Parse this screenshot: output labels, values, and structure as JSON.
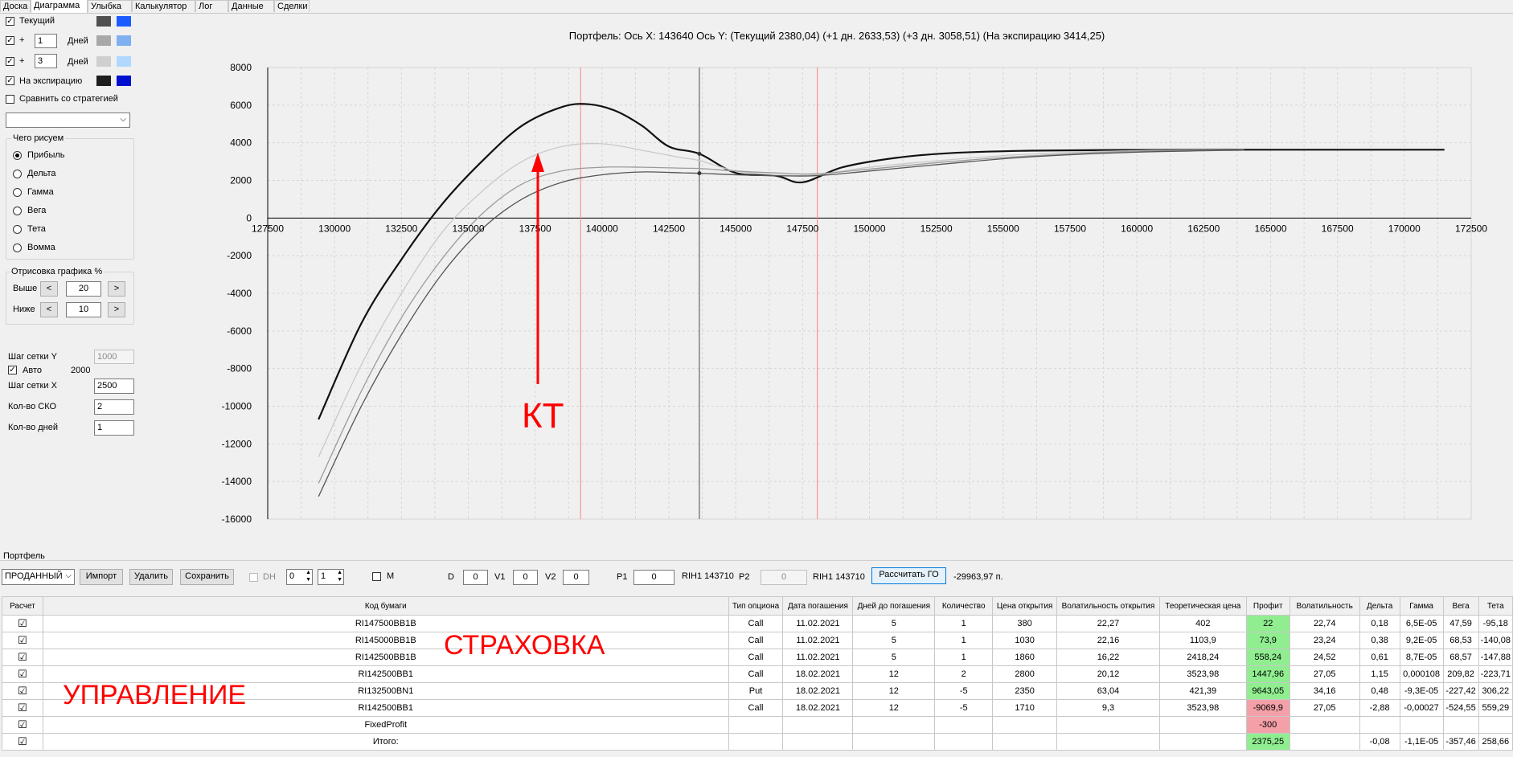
{
  "tabs": [
    "Доска",
    "Диаграмма",
    "Улыбка",
    "Калькулятор",
    "Лог",
    "Данные",
    "Сделки"
  ],
  "active_tab": "Диаграмма",
  "left": {
    "current_label": "Текущий",
    "plus": "+",
    "days_1": "1",
    "days_3": "3",
    "days_label": "Дней",
    "expiry_label": "На экспирацию",
    "compare_label": "Сравнить со стратегией",
    "what_title": "Чего рисуем",
    "radios": [
      "Прибыль",
      "Дельта",
      "Гамма",
      "Вега",
      "Тета",
      "Вомма"
    ],
    "render_title": "Отрисовка графика %",
    "above_label": "Выше",
    "above_value": "20",
    "below_label": "Ниже",
    "below_value": "10",
    "left_btn": "<",
    "right_btn": ">",
    "grid_y_label": "Шаг сетки Y",
    "grid_y_value": "1000",
    "auto_label": "Авто",
    "auto_value": "2000",
    "grid_x_label": "Шаг сетки X",
    "grid_x_value": "2500",
    "sko_label": "Кол-во СКО",
    "sko_value": "2",
    "days_count_label": "Кол-во дней",
    "days_count_value": "1"
  },
  "colors": {
    "current": [
      "#505050",
      "#1c5cff"
    ],
    "plus1": [
      "#a8a8a8",
      "#7fb0f0"
    ],
    "plus3": [
      "#cfcfcf",
      "#b0d8ff"
    ],
    "expiry": [
      "#1e1e1e",
      "#0010d0"
    ]
  },
  "chart_title": "Портфель: Ось X: 143640 Ось Y:  (Текущий 2380,04)  (+1 дн. 2633,53)  (+3 дн. 3058,51)  (На экспирацию 3414,25)",
  "chart_data": {
    "type": "line",
    "xlim": [
      127500,
      172500
    ],
    "ylim": [
      -16000,
      8000
    ],
    "x_ticks": [
      127500,
      130000,
      132500,
      135000,
      137500,
      140000,
      142500,
      145000,
      147500,
      150000,
      152500,
      155000,
      157500,
      160000,
      162500,
      165000,
      167500,
      170000,
      172500
    ],
    "y_ticks": [
      8000,
      6000,
      4000,
      2000,
      0,
      -2000,
      -4000,
      -6000,
      -8000,
      -10000,
      -12000,
      -14000,
      -16000
    ],
    "cursor_x": 143640,
    "red_lines": [
      139200,
      148050
    ],
    "series": [
      {
        "x": [
          129400,
          131000,
          132500,
          134000,
          135500,
          137000,
          138500,
          139500,
          140500,
          141500,
          142500,
          143640,
          145000,
          146500,
          147500,
          149000,
          151000,
          153000,
          156000,
          160000,
          164000,
          168000,
          171500
        ],
        "y": [
          -10700,
          -5600,
          -2200,
          700,
          3000,
          4900,
          5900,
          6050,
          5700,
          4900,
          3800,
          3414,
          2400,
          2250,
          1900,
          2700,
          3200,
          3450,
          3580,
          3620,
          3630,
          3630,
          3630
        ]
      },
      {
        "x": [
          129400,
          131000,
          132500,
          134000,
          135500,
          137000,
          138500,
          140000,
          141500,
          143000,
          143640,
          145000,
          146500,
          148000,
          150000,
          153000,
          156000,
          160000,
          164000
        ],
        "y": [
          -12700,
          -7800,
          -4000,
          -800,
          1400,
          3000,
          3800,
          3950,
          3600,
          3200,
          3059,
          2500,
          2300,
          2300,
          2700,
          3100,
          3400,
          3580,
          3620
        ]
      },
      {
        "x": [
          129400,
          131000,
          132500,
          134000,
          135500,
          137000,
          138500,
          140000,
          141500,
          143000,
          143640,
          145000,
          146500,
          148000,
          150000,
          153000,
          156000,
          160000,
          164000
        ],
        "y": [
          -14100,
          -9200,
          -5300,
          -2200,
          200,
          1800,
          2500,
          2700,
          2700,
          2650,
          2634,
          2500,
          2400,
          2350,
          2600,
          3000,
          3300,
          3550,
          3620
        ]
      },
      {
        "x": [
          129400,
          131000,
          132500,
          134000,
          135500,
          137000,
          138500,
          140000,
          141500,
          143000,
          143640,
          145000,
          146500,
          148000,
          150000,
          153000,
          156000,
          160000,
          164000
        ],
        "y": [
          -14800,
          -10000,
          -6200,
          -3000,
          -600,
          1000,
          1900,
          2300,
          2450,
          2400,
          2380,
          2300,
          2250,
          2250,
          2500,
          2900,
          3250,
          3500,
          3610
        ]
      }
    ]
  },
  "annotation_kt": "КТ",
  "annotation_insurance": "СТРАХОВКА",
  "annotation_management": "УПРАВЛЕНИЕ",
  "portfolio": {
    "title": "Портфель",
    "select_value": "ПРОДАННЫЙ",
    "import": "Импорт",
    "delete": "Удалить",
    "save": "Сохранить",
    "dh": "DH",
    "num_a": "0",
    "num_b": "1",
    "m": "M",
    "d_label": "D",
    "d_value": "0",
    "v1_label": "V1",
    "v1_value": "0",
    "v2_label": "V2",
    "v2_value": "0",
    "p1_label": "P1",
    "p1_value": "0",
    "rih1": "RIH1 143710",
    "p2_label": "P2",
    "p2_value": "0",
    "rih2": "RIH1 143710",
    "calc": "Рассчитать ГО",
    "go_value": "-29963,97 п."
  },
  "table": {
    "headers": [
      "Расчет",
      "Код бумаги",
      "Тип опциона",
      "Дата погашения",
      "Дней до погашения",
      "Количество",
      "Цена открытия",
      "Волатильность открытия",
      "Теоретическая цена",
      "Профит",
      "Волатильность",
      "Дельта",
      "Гамма",
      "Вега",
      "Тета"
    ],
    "rows": [
      [
        "☑",
        "RI147500BB1B",
        "Call",
        "11.02.2021",
        "5",
        "1",
        "380",
        "22,27",
        "402",
        "22",
        "22,74",
        "0,18",
        "6,5E-05",
        "47,59",
        "-95,18"
      ],
      [
        "☑",
        "RI145000BB1B",
        "Call",
        "11.02.2021",
        "5",
        "1",
        "1030",
        "22,16",
        "1103,9",
        "73,9",
        "23,24",
        "0,38",
        "9,2E-05",
        "68,53",
        "-140,08"
      ],
      [
        "☑",
        "RI142500BB1B",
        "Call",
        "11.02.2021",
        "5",
        "1",
        "1860",
        "16,22",
        "2418,24",
        "558,24",
        "24,52",
        "0,61",
        "8,7E-05",
        "68,57",
        "-147,88"
      ],
      [
        "☑",
        "RI142500BB1",
        "Call",
        "18.02.2021",
        "12",
        "2",
        "2800",
        "20,12",
        "3523,98",
        "1447,96",
        "27,05",
        "1,15",
        "0,000108",
        "209,82",
        "-223,71"
      ],
      [
        "☑",
        "RI132500BN1",
        "Put",
        "18.02.2021",
        "12",
        "-5",
        "2350",
        "63,04",
        "421,39",
        "9643,05",
        "34,16",
        "0,48",
        "-9,3E-05",
        "-227,42",
        "306,22"
      ],
      [
        "☑",
        "RI142500BB1",
        "Call",
        "18.02.2021",
        "12",
        "-5",
        "1710",
        "9,3",
        "3523,98",
        "-9069,9",
        "27,05",
        "-2,88",
        "-0,00027",
        "-524,55",
        "559,29"
      ],
      [
        "☑",
        "FixedProfit",
        "",
        "",
        "",
        "",
        "",
        "",
        "",
        "-300",
        "",
        "",
        "",
        "",
        ""
      ],
      [
        "☑",
        "Итого:",
        "",
        "",
        "",
        "",
        "",
        "",
        "",
        "2375,25",
        "",
        "-0,08",
        "-1,1E-05",
        "-357,46",
        "258,66"
      ]
    ],
    "profit_colors": [
      "green",
      "green",
      "green",
      "green",
      "green",
      "red",
      "red",
      "green"
    ]
  }
}
